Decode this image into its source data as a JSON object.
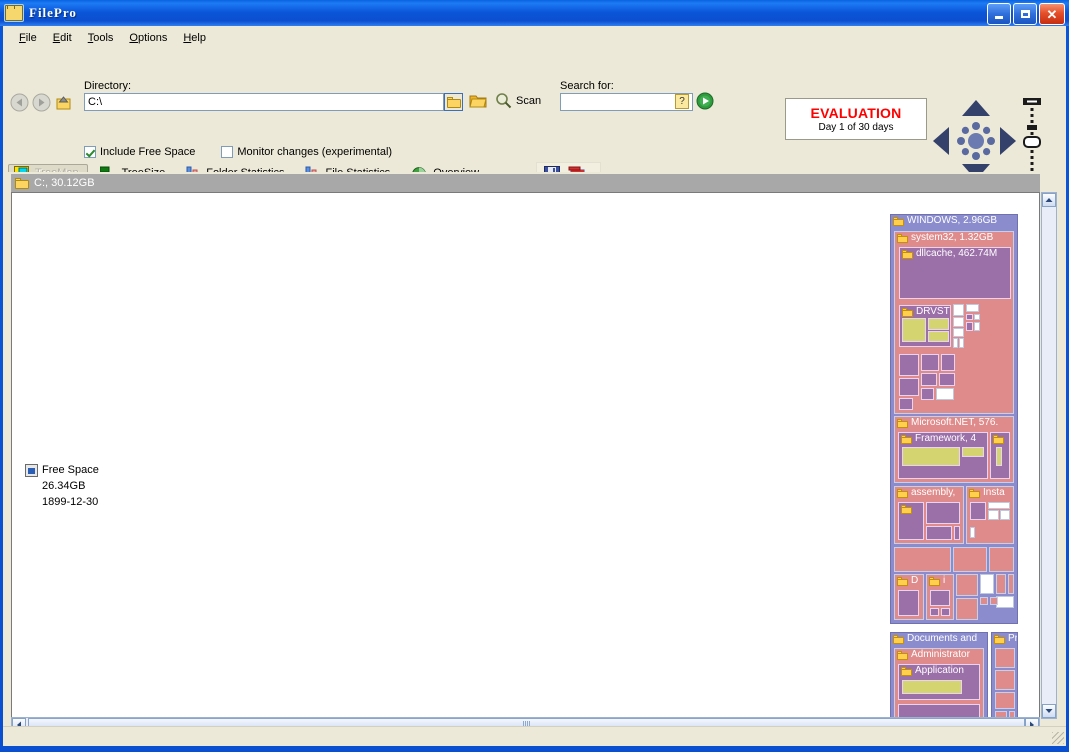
{
  "window": {
    "title": "FilePro",
    "icon": "folder-icon",
    "minimize_label": "Minimize",
    "maximize_label": "Maximize",
    "close_label": "Close"
  },
  "menu": [
    {
      "label": "File",
      "accel": "F"
    },
    {
      "label": "Edit",
      "accel": "E"
    },
    {
      "label": "Tools",
      "accel": "T"
    },
    {
      "label": "Options",
      "accel": "O"
    },
    {
      "label": "Help",
      "accel": "H"
    }
  ],
  "toolbar": {
    "directory_label": "Directory:",
    "directory_value": "C:\\",
    "directory_placeholder": "",
    "back_label": "Back",
    "forward_label": "Forward",
    "up_label": "Up one level",
    "browse_label": "Browse",
    "open_folder_label": "Open folder",
    "scan_label": "Scan",
    "search_label": "Search for:",
    "search_value": "",
    "search_placeholder": "",
    "search_help_label": "?",
    "search_go_label": "Go",
    "save_label": "Save",
    "report_label": "Report"
  },
  "checkboxes": [
    {
      "label": "Include Free Space",
      "checked": true
    },
    {
      "label": "Monitor changes (experimental)",
      "checked": false
    }
  ],
  "view_tabs": [
    {
      "label": "TreeMap",
      "icon": "treemap-icon",
      "active": true
    },
    {
      "label": "TreeSize",
      "icon": "treesize-icon",
      "active": false
    },
    {
      "label": "Folder Statistics",
      "icon": "bar-chart-icon",
      "active": false
    },
    {
      "label": "File Statistics",
      "icon": "bar-chart-icon",
      "active": false
    },
    {
      "label": "Overview",
      "icon": "pie-chart-icon",
      "active": false
    }
  ],
  "evaluation": {
    "title": "EVALUATION",
    "subtitle": "Day 1 of 30 days",
    "title_color": "#ff0000"
  },
  "navpad": {
    "up_label": "Pan up",
    "down_label": "Pan down",
    "left_label": "Pan left",
    "right_label": "Pan right",
    "center_label": "Reset view",
    "zoom_in_label": "Zoom in",
    "zoom_out_label": "Zoom out",
    "zoom_handle_label": "Zoom level"
  },
  "panel": {
    "header": "C:, 30.12GB",
    "header_icon": "folder-icon"
  },
  "free_space": {
    "icon": "disk-icon",
    "name": "Free Space",
    "size": "26.34GB",
    "date": "1899-12-30"
  },
  "colors": {
    "title_accent": "#0a55d8",
    "eval_red": "#ff0000",
    "treemap_outer": "#8a8ccd",
    "treemap_folder": "#df8b8b",
    "treemap_file": "#9b6fa8",
    "treemap_highlight": "#d4d471",
    "panel_header": "#a8a8a8"
  },
  "treemap": {
    "blocks": [
      {
        "name": "WINDOWS",
        "size": "2.96GB",
        "label": "WINDOWS, 2.96GB"
      },
      {
        "name": "system32",
        "size": "1.32GB",
        "label": "system32, 1.32GB"
      },
      {
        "name": "dllcache",
        "size": "462.74M",
        "label": "dllcache, 462.74M"
      },
      {
        "name": "DRVSTORE",
        "size": "",
        "label": "DRVST"
      },
      {
        "name": "Microsoft.NET",
        "size": "576.",
        "label": "Microsoft.NET, 576."
      },
      {
        "name": "Framework",
        "size": "4",
        "label": "Framework, 4"
      },
      {
        "name": "assembly",
        "size": "",
        "label": "assembly,"
      },
      {
        "name": "Installer",
        "size": "",
        "label": "Insta"
      },
      {
        "name": "Downloaded",
        "size": "",
        "label": "D"
      },
      {
        "name": "inf",
        "size": "",
        "label": "i"
      },
      {
        "name": "Documents and Settings",
        "size": "",
        "label": "Documents and"
      },
      {
        "name": "Administrator",
        "size": "",
        "label": "Administrator"
      },
      {
        "name": "Application Data",
        "size": "",
        "label": "Application"
      },
      {
        "name": "Program Files",
        "size": "",
        "label": "Pr"
      }
    ]
  },
  "scrollbars": {
    "v_up_label": "Scroll up",
    "v_down_label": "Scroll down",
    "h_left_label": "Scroll left",
    "h_right_label": "Scroll right"
  }
}
